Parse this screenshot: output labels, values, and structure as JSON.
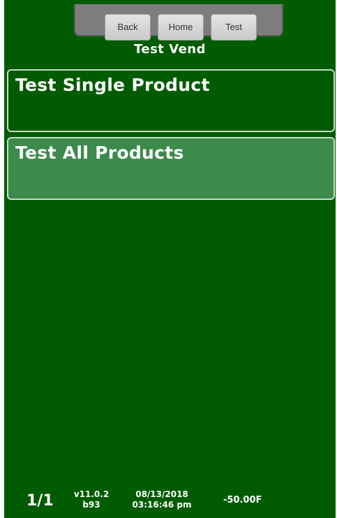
{
  "nav": {
    "back_label": "Back",
    "home_label": "Home",
    "test_label": "Test"
  },
  "page_title": "Test Vend",
  "menu": {
    "items": [
      {
        "label": "Test Single Product"
      },
      {
        "label": "Test All Products"
      }
    ]
  },
  "footer": {
    "page": "1/1",
    "version": "v11.0.2",
    "build": "b93",
    "date": "08/13/2018",
    "time": "03:16:46 pm",
    "temperature": "-50.00F"
  },
  "colors": {
    "background": "#015c01",
    "selected_item": "#3c8a4c",
    "nav_bar": "#7d7d7d"
  }
}
